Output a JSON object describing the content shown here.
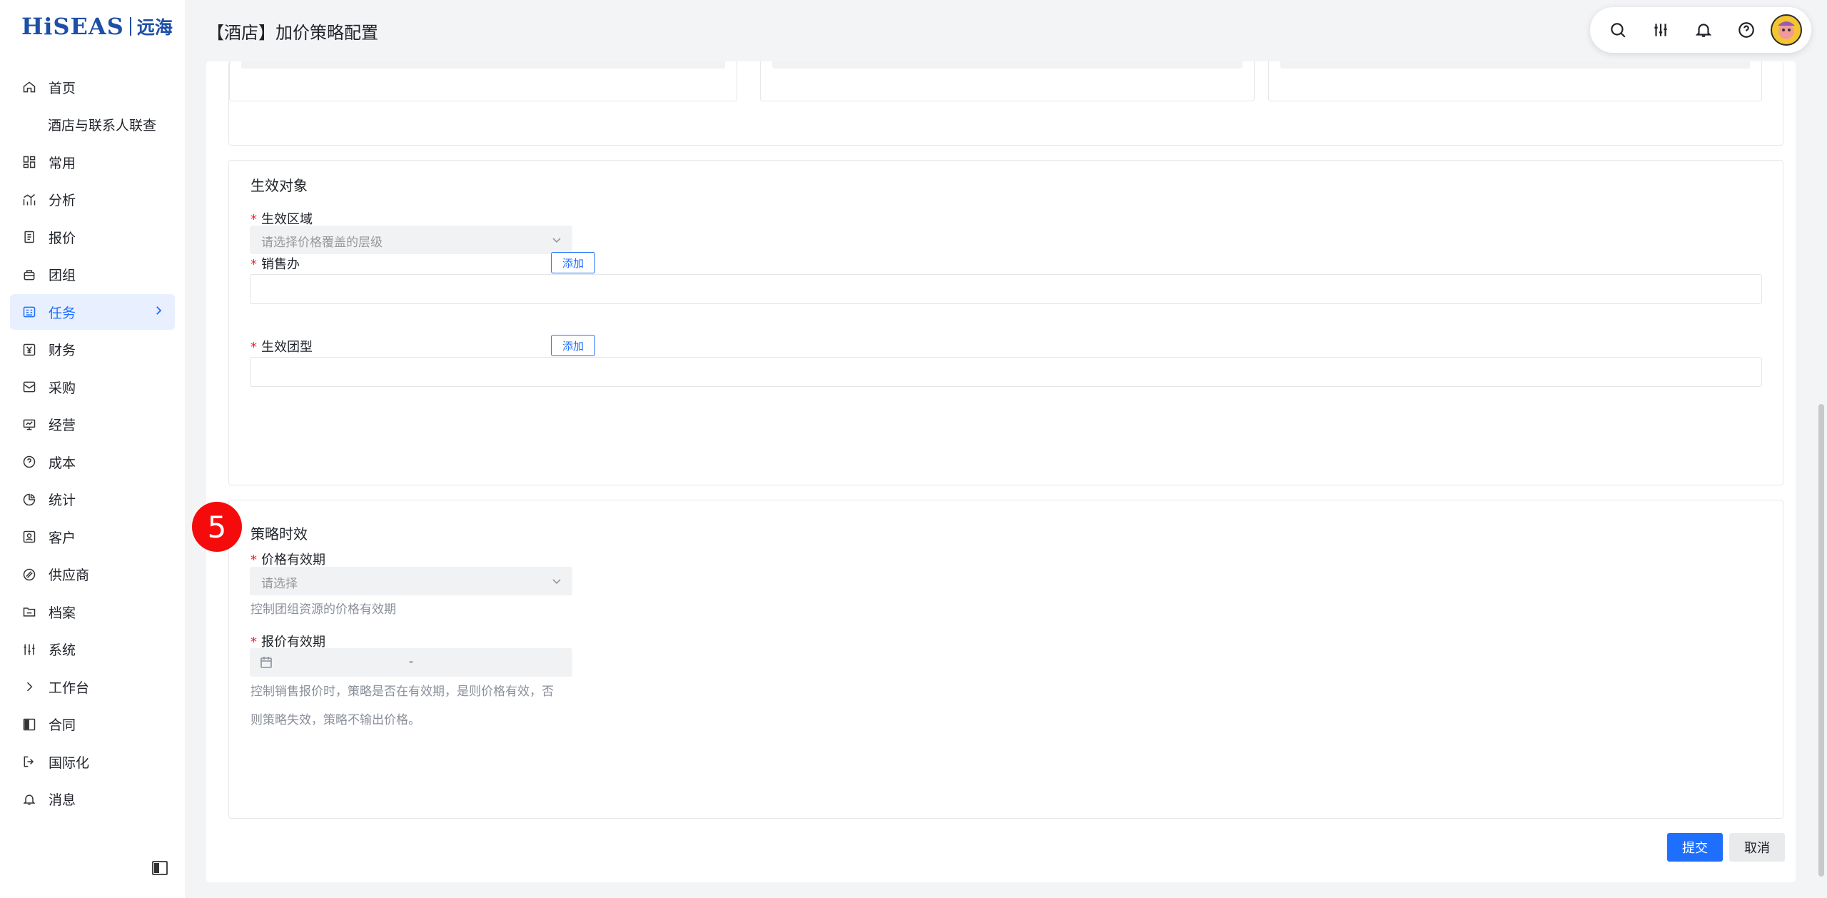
{
  "brand": {
    "logo_text": "HiSEAS",
    "logo_cn": "远海"
  },
  "sidebar": {
    "items": [
      {
        "label": "首页",
        "icon": "home-icon"
      },
      {
        "label": "酒店与联系人联查",
        "icon": ""
      },
      {
        "label": "常用",
        "icon": "dashboard-icon"
      },
      {
        "label": "分析",
        "icon": "chart-icon"
      },
      {
        "label": "报价",
        "icon": "document-icon"
      },
      {
        "label": "团组",
        "icon": "group-icon"
      },
      {
        "label": "任务",
        "icon": "task-icon",
        "active": true
      },
      {
        "label": "财务",
        "icon": "yen-icon"
      },
      {
        "label": "采购",
        "icon": "mail-icon"
      },
      {
        "label": "经营",
        "icon": "monitor-icon"
      },
      {
        "label": "成本",
        "icon": "question-icon"
      },
      {
        "label": "统计",
        "icon": "pie-icon"
      },
      {
        "label": "客户",
        "icon": "contact-icon"
      },
      {
        "label": "供应商",
        "icon": "supplier-icon"
      },
      {
        "label": "档案",
        "icon": "folder-icon"
      },
      {
        "label": "系统",
        "icon": "sliders-icon"
      },
      {
        "label": "工作台",
        "icon": "chevron-right-icon"
      },
      {
        "label": "合同",
        "icon": "contract-icon"
      },
      {
        "label": "国际化",
        "icon": "logout-icon"
      },
      {
        "label": "消息",
        "icon": "bell-icon"
      }
    ]
  },
  "header": {
    "title": "【酒店】加价策略配置",
    "toolbar_icons": [
      "search-icon",
      "sliders-icon",
      "bell-icon",
      "help-icon",
      "avatar"
    ]
  },
  "target_section": {
    "title": "生效对象",
    "region_label": "生效区域",
    "region_placeholder": "请选择价格覆盖的层级",
    "office_label": "销售办",
    "office_add": "添加",
    "group_type_label": "生效团型",
    "group_type_add": "添加"
  },
  "timing_section": {
    "step_number": "5",
    "title": "策略时效",
    "price_validity_label": "价格有效期",
    "price_validity_placeholder": "请选择",
    "price_validity_help": "控制团组资源的价格有效期",
    "quote_validity_label": "报价有效期",
    "quote_validity_separator": "-",
    "quote_validity_help_line1": "控制销售报价时，策略是否在有效期，是则价格有效，否",
    "quote_validity_help_line2": "则策略失效，策略不输出价格。"
  },
  "actions": {
    "submit": "提交",
    "cancel": "取消"
  },
  "colors": {
    "accent": "#1f6fff",
    "required": "#f5222d",
    "step_badge": "#f50b0b"
  }
}
